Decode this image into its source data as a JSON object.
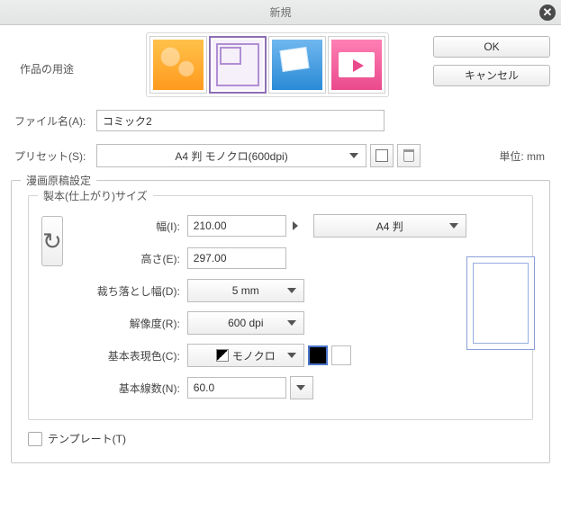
{
  "title": "新規",
  "buttons": {
    "ok": "OK",
    "cancel": "キャンセル"
  },
  "purpose": {
    "label": "作品の用途"
  },
  "filename": {
    "label": "ファイル名(A):",
    "value": "コミック2"
  },
  "preset": {
    "label": "プリセット(S):",
    "value": "A4 判 モノクロ(600dpi)"
  },
  "unit": {
    "label": "単位:",
    "value": "mm"
  },
  "section": {
    "manga": "漫画原稿設定",
    "binding": "製本(仕上がり)サイズ"
  },
  "fields": {
    "width": {
      "label": "幅(I):",
      "value": "210.00"
    },
    "height": {
      "label": "高さ(E):",
      "value": "297.00"
    },
    "bleed": {
      "label": "裁ち落とし幅(D):",
      "value": "5  mm"
    },
    "dpi": {
      "label": "解像度(R):",
      "value": "600 dpi"
    },
    "color": {
      "label": "基本表現色(C):",
      "value": "モノクロ"
    },
    "lines": {
      "label": "基本線数(N):",
      "value": "60.0"
    },
    "paper": {
      "value": "A4  判"
    }
  },
  "template": {
    "label": "テンプレート(T)"
  }
}
